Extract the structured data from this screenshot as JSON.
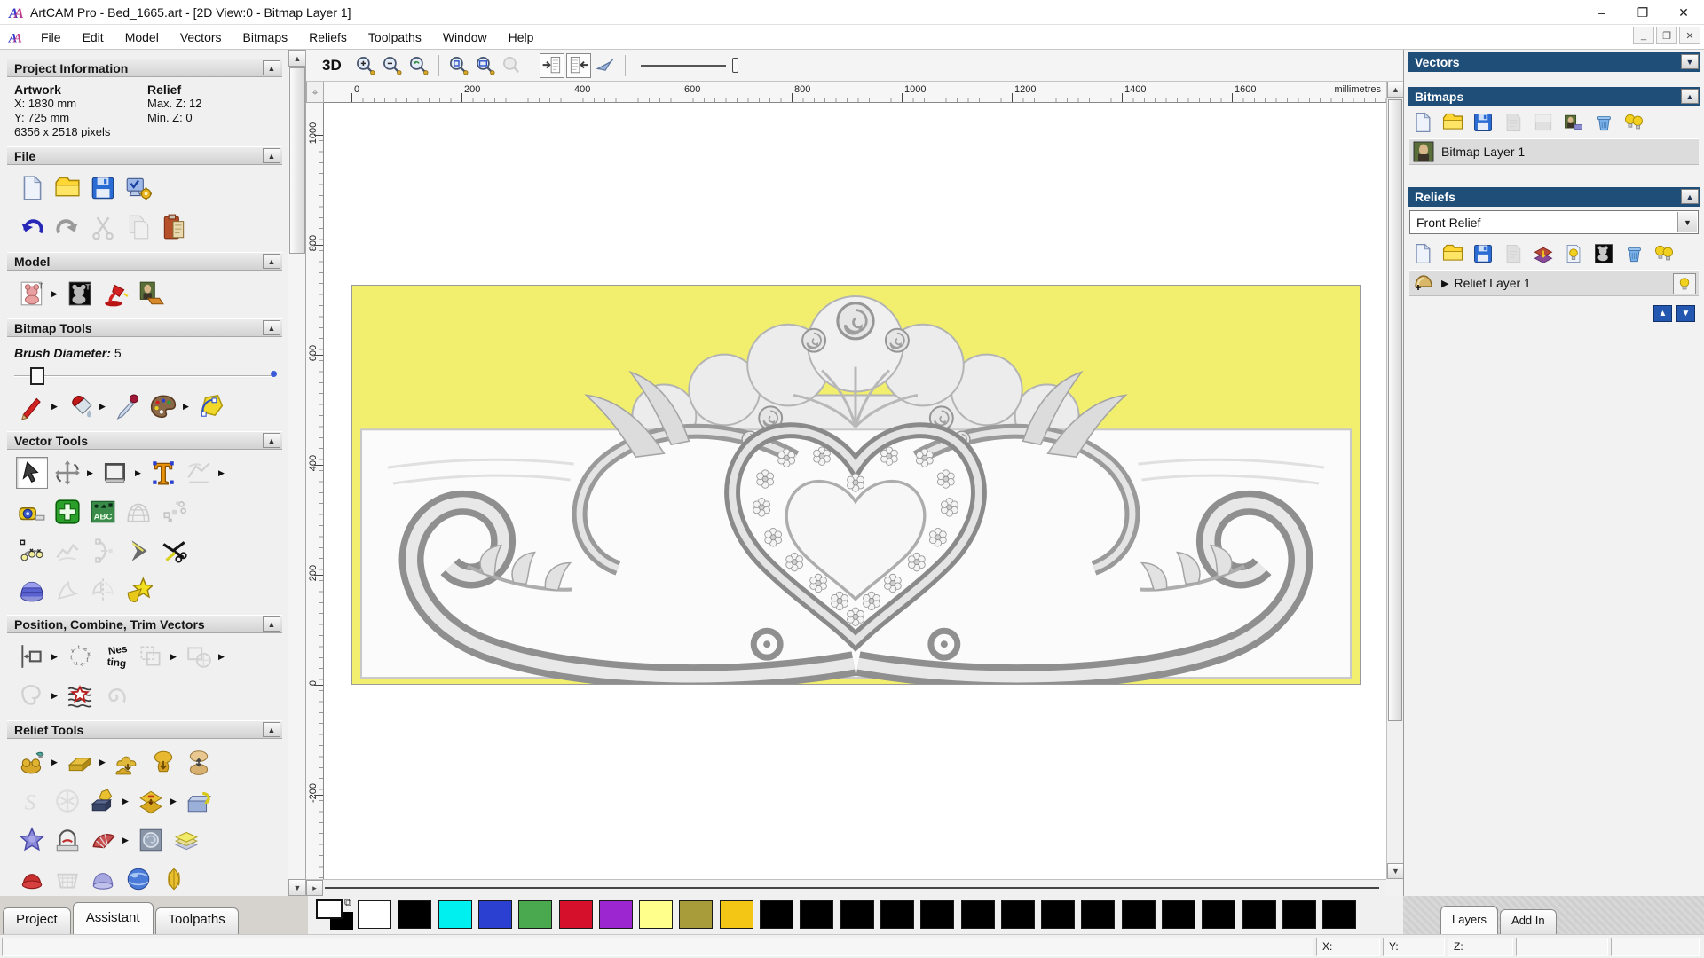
{
  "window": {
    "title": "ArtCAM Pro - Bed_1665.art - [2D View:0 - Bitmap Layer 1]",
    "controls": {
      "minimize": "–",
      "maximize": "❐",
      "close": "✕"
    },
    "mdi_controls": {
      "minimize": "_",
      "restore": "❐",
      "close": "✕"
    }
  },
  "menu": {
    "items": [
      "File",
      "Edit",
      "Model",
      "Vectors",
      "Bitmaps",
      "Reliefs",
      "Toolpaths",
      "Window",
      "Help"
    ]
  },
  "left_panel": {
    "project_information": {
      "title": "Project Information",
      "artwork_label": "Artwork",
      "artwork_x": "X: 1830 mm",
      "artwork_y": "Y: 725 mm",
      "artwork_pixels": "6356 x 2518 pixels",
      "relief_label": "Relief",
      "relief_max": "Max. Z: 12",
      "relief_min": "Min. Z: 0"
    },
    "file": {
      "title": "File"
    },
    "model": {
      "title": "Model"
    },
    "bitmap_tools": {
      "title": "Bitmap Tools",
      "brush_label": "Brush Diameter:",
      "brush_value": "5"
    },
    "vector_tools": {
      "title": "Vector Tools"
    },
    "position_combine": {
      "title": "Position, Combine, Trim Vectors"
    },
    "relief_tools": {
      "title": "Relief Tools"
    },
    "tabs": [
      {
        "label": "Project",
        "active": false
      },
      {
        "label": "Assistant",
        "active": true
      },
      {
        "label": "Toolpaths",
        "active": false
      }
    ]
  },
  "toolbars": {
    "view_3d_label": "3D",
    "view_row": [
      "zoom-in",
      "zoom-out",
      "zoom-previous",
      "|",
      "zoom-1to1",
      "zoom-fit",
      "~zoom-object",
      "|",
      "toggle-prev!",
      "toggle-next!",
      "view-light",
      "|"
    ],
    "file_row1": [
      "new-file",
      "open-folder",
      "save",
      "preferences"
    ],
    "file_row2": [
      "undo",
      "redo",
      "~cut",
      "~copy",
      "paste"
    ],
    "model_row": [
      "import-model*",
      "invert-model",
      "lighting",
      "texture"
    ],
    "bitmap_row": [
      "paint*",
      "flood-fill*",
      "colour-picker",
      "palette*",
      "bitmap-to-vector"
    ],
    "vector_row1": [
      "select!",
      "transform*",
      "rectangle*",
      "text",
      "~measure*"
    ],
    "vector_row2": [
      "tape-measure",
      "health-check",
      "text-in-box",
      "~mesh-creator",
      "~block-copy"
    ],
    "vector_row3": [
      "node-edit",
      "~free-poly",
      "~arc-edit",
      "chevron",
      "trim"
    ],
    "vector_row4": [
      "extrude-dome",
      "~polyline",
      "~mirror-half",
      "star"
    ],
    "position_row1": [
      "align*",
      "text-on-curve",
      "nesting",
      "~group*",
      "~combine*"
    ],
    "position_row2": [
      "~weld*",
      "vector-texture",
      "~spiral"
    ],
    "relief_row1": [
      "relief-wizard*",
      "zero-plane*",
      "add-relief",
      "merge-high",
      "scale-relief"
    ],
    "relief_row2": [
      "~sculpt",
      "~weave",
      "relief-from-image*",
      "offset-relief*",
      "load-relief"
    ],
    "relief_row3": [
      "star-wizard",
      "shape-arch",
      "fan-relief*",
      "texture-relief",
      "relief-layers"
    ],
    "relief_row4": [
      "red-tool",
      "~basket",
      "dome-tool",
      "sphere-tool",
      "gold-fan"
    ],
    "bitmaps_panel_row": [
      "new-file",
      "open-folder",
      "save",
      "~sheet",
      "~gradient",
      "bitmap-thumb",
      "delete",
      "visibility"
    ],
    "reliefs_panel_row": [
      "new-file",
      "open-folder",
      "save",
      "~sheet",
      "stack-transfer",
      "bulb-page",
      "greyscale-preview",
      "delete",
      "visibility"
    ]
  },
  "ruler": {
    "h_ticks": [
      "0",
      "200",
      "400",
      "600",
      "800",
      "1000",
      "1200",
      "1400",
      "1600"
    ],
    "v_ticks": [
      "1000",
      "800",
      "600",
      "400",
      "200",
      "0",
      "-200"
    ],
    "unit": "millimetres"
  },
  "canvas": {
    "artwork_background": "#f1ef6d",
    "panel_white": "#fafafa",
    "relief_gray": "#9a9a9a"
  },
  "right_panel": {
    "vectors": {
      "title": "Vectors"
    },
    "bitmaps": {
      "title": "Bitmaps",
      "layer_name": "Bitmap Layer 1"
    },
    "reliefs": {
      "title": "Reliefs",
      "dropdown_value": "Front Relief",
      "layer_name": "Relief Layer 1"
    },
    "tabs": [
      {
        "label": "Layers",
        "active": true
      },
      {
        "label": "Add In",
        "active": false
      }
    ]
  },
  "palette": {
    "swatches": [
      "#ffffff",
      "#000000",
      "#00f0f0",
      "#2b3fd0",
      "#4aa84e",
      "#d4102a",
      "#9c27d0",
      "#ffff8c",
      "#a79b3a",
      "#f3c515",
      "#000000",
      "#000000",
      "#000000",
      "#000000",
      "#000000",
      "#000000",
      "#000000",
      "#000000",
      "#000000",
      "#000000",
      "#000000",
      "#000000",
      "#000000",
      "#000000",
      "#000000"
    ]
  },
  "status_bar": {
    "x_label": "X:",
    "y_label": "Y:",
    "z_label": "Z:"
  }
}
